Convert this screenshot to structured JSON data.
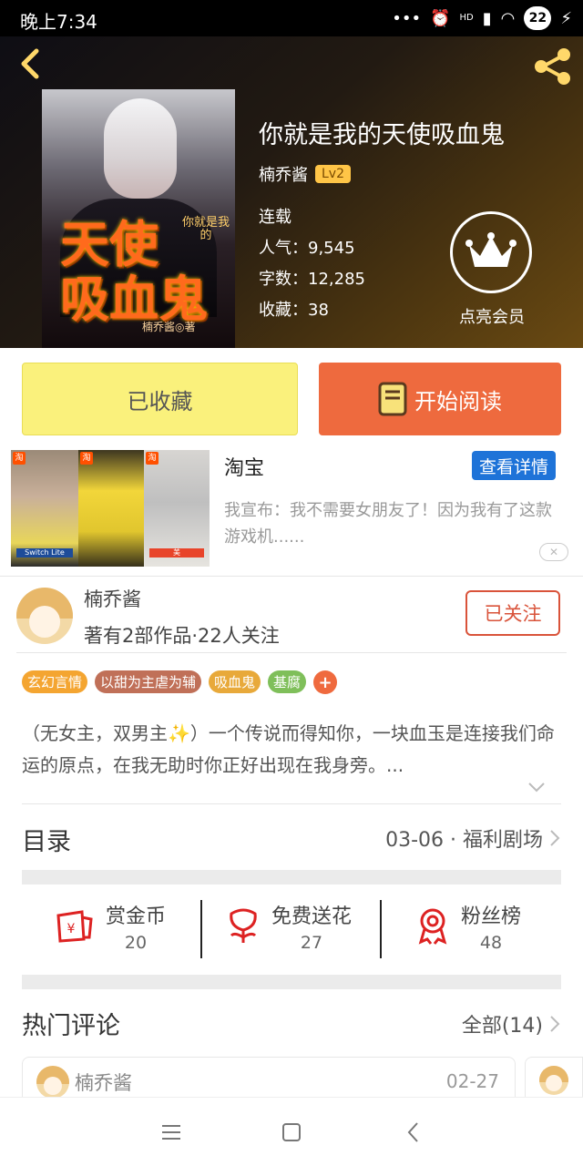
{
  "status_bar": {
    "time": "晚上7:34",
    "signal_type": "HD",
    "battery": "22"
  },
  "book": {
    "title": "你就是我的天使吸血鬼",
    "author": "楠乔酱",
    "level": "Lv2",
    "status": "连载",
    "popularity": "人气：9,545",
    "word_count": "字数：12,285",
    "favorites": "收藏：38",
    "cover": {
      "title_line1": "天使",
      "title_line2": "吸血鬼",
      "subtitle": "你就是我的",
      "author_mark": "楠乔酱◎著"
    }
  },
  "membership": {
    "label": "点亮会员"
  },
  "actions": {
    "favorited": "已收藏",
    "start_reading": "开始阅读"
  },
  "ad": {
    "title": "淘宝",
    "detail_button": "查看详情",
    "description": "我宣布：我不需要女朋友了！因为我有了这款游戏机......",
    "badge": "淘",
    "caption1": "Switch Lite",
    "caption3": "美"
  },
  "author_block": {
    "name": "楠乔酱",
    "meta": "著有2部作品·22人关注",
    "follow": "已关注"
  },
  "tags": [
    {
      "label": "玄幻言情",
      "color": "#f4a531"
    },
    {
      "label": "以甜为主虐为辅",
      "color": "#c07058"
    },
    {
      "label": "吸血鬼",
      "color": "#e8a93a"
    },
    {
      "label": "基腐",
      "color": "#7fbf5a"
    }
  ],
  "tag_add": "+",
  "synopsis": "（无女主，双男主✨）一个传说而得知你，一块血玉是连接我们命运的原点，在我无助时你正好出现在我身旁。...",
  "toc": {
    "title": "目录",
    "latest": "03-06 · 福利剧场"
  },
  "rewards": [
    {
      "label": "赏金币",
      "value": "20"
    },
    {
      "label": "免费送花",
      "value": "27"
    },
    {
      "label": "粉丝榜",
      "value": "48"
    }
  ],
  "comments": {
    "title": "热门评论",
    "all": "全部(14)",
    "first_user": "楠乔酱",
    "first_date": "02-27"
  },
  "colors": {
    "accent": "#ee6a3e",
    "fav_button": "#faf17c",
    "link_blue": "#1e73d8"
  }
}
